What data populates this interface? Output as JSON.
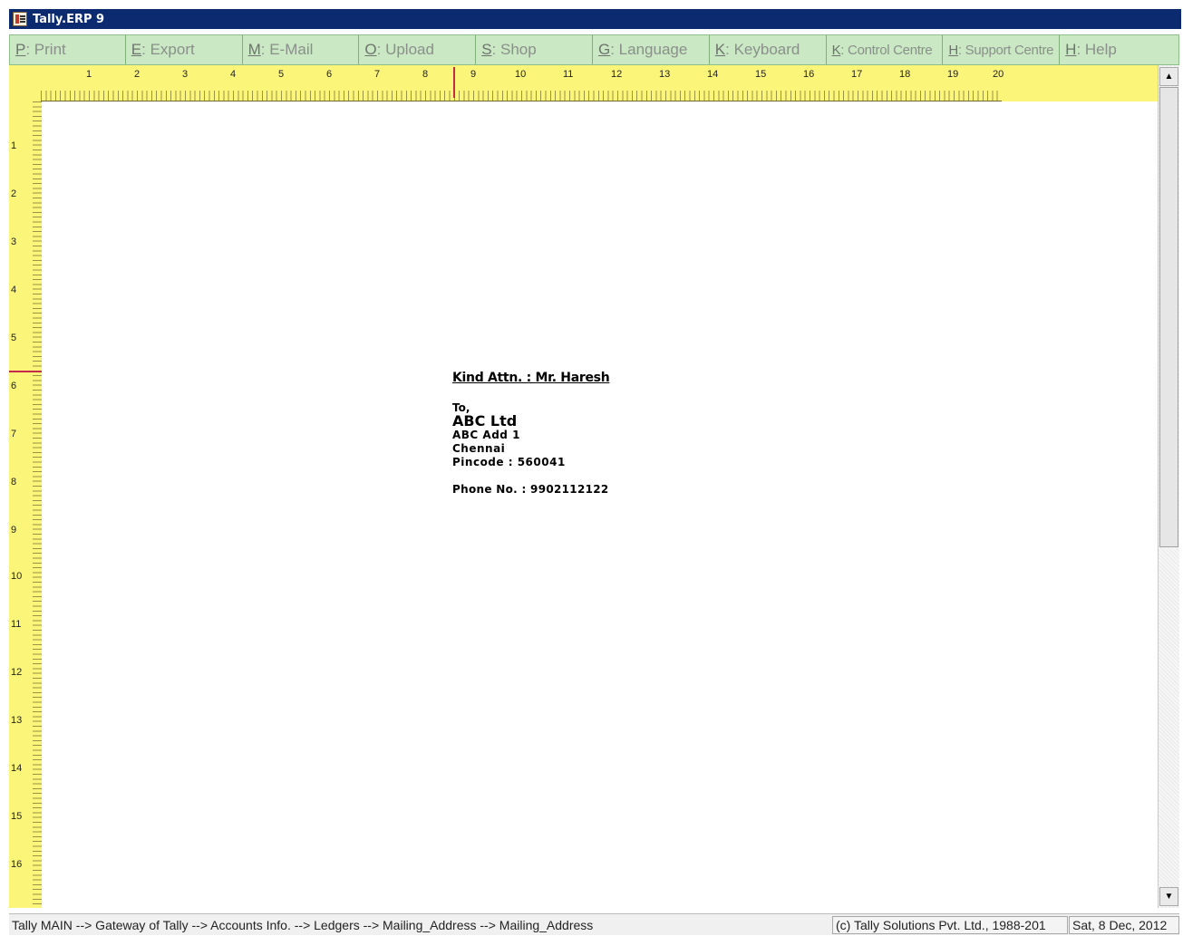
{
  "window": {
    "title": "Tally.ERP 9"
  },
  "toolbar": {
    "buttons": [
      {
        "key": "P",
        "label": ": Print"
      },
      {
        "key": "E",
        "label": ": Export"
      },
      {
        "key": "M",
        "label": ": E-Mail"
      },
      {
        "key": "O",
        "label": ": Upload"
      },
      {
        "key": "S",
        "label": ": Shop"
      },
      {
        "key": "G",
        "label": ": Language"
      },
      {
        "key": "K",
        "label": ": Keyboard"
      },
      {
        "key": "K",
        "label": ": Control Centre"
      },
      {
        "key": "H",
        "label": ": Support Centre"
      },
      {
        "key": "H",
        "label": ": Help"
      }
    ]
  },
  "ruler": {
    "horizontal": [
      "1",
      "2",
      "3",
      "4",
      "5",
      "6",
      "7",
      "8",
      "9",
      "10",
      "11",
      "12",
      "13",
      "14",
      "15",
      "16",
      "17",
      "18",
      "19",
      "20"
    ],
    "vertical": [
      "1",
      "2",
      "3",
      "4",
      "5",
      "6",
      "7",
      "8",
      "9",
      "10",
      "11",
      "12",
      "13",
      "14",
      "15",
      "16"
    ]
  },
  "letter": {
    "attn": "Kind Attn. : Mr. Haresh",
    "to": "To,",
    "company": "ABC Ltd",
    "address1": "ABC Add 1",
    "city": "Chennai",
    "pincode": "Pincode : 560041",
    "phone": "Phone No. : 9902112122"
  },
  "statusbar": {
    "breadcrumb": "Tally MAIN --> Gateway of Tally --> Accounts Info. --> Ledgers --> Mailing_Address --> Mailing_Address",
    "copyright": "(c) Tally Solutions Pvt. Ltd., 1988-201",
    "date": "Sat, 8 Dec, 2012"
  },
  "colors": {
    "titlebar": "#0b2a6f",
    "toolbar": "#c9e8c3",
    "ruler": "#fbf57a",
    "ruler_marker": "#c8284a"
  },
  "icons": {
    "app": "tally-app-icon",
    "scroll_up": "arrow-up-icon",
    "scroll_down": "arrow-down-icon"
  }
}
